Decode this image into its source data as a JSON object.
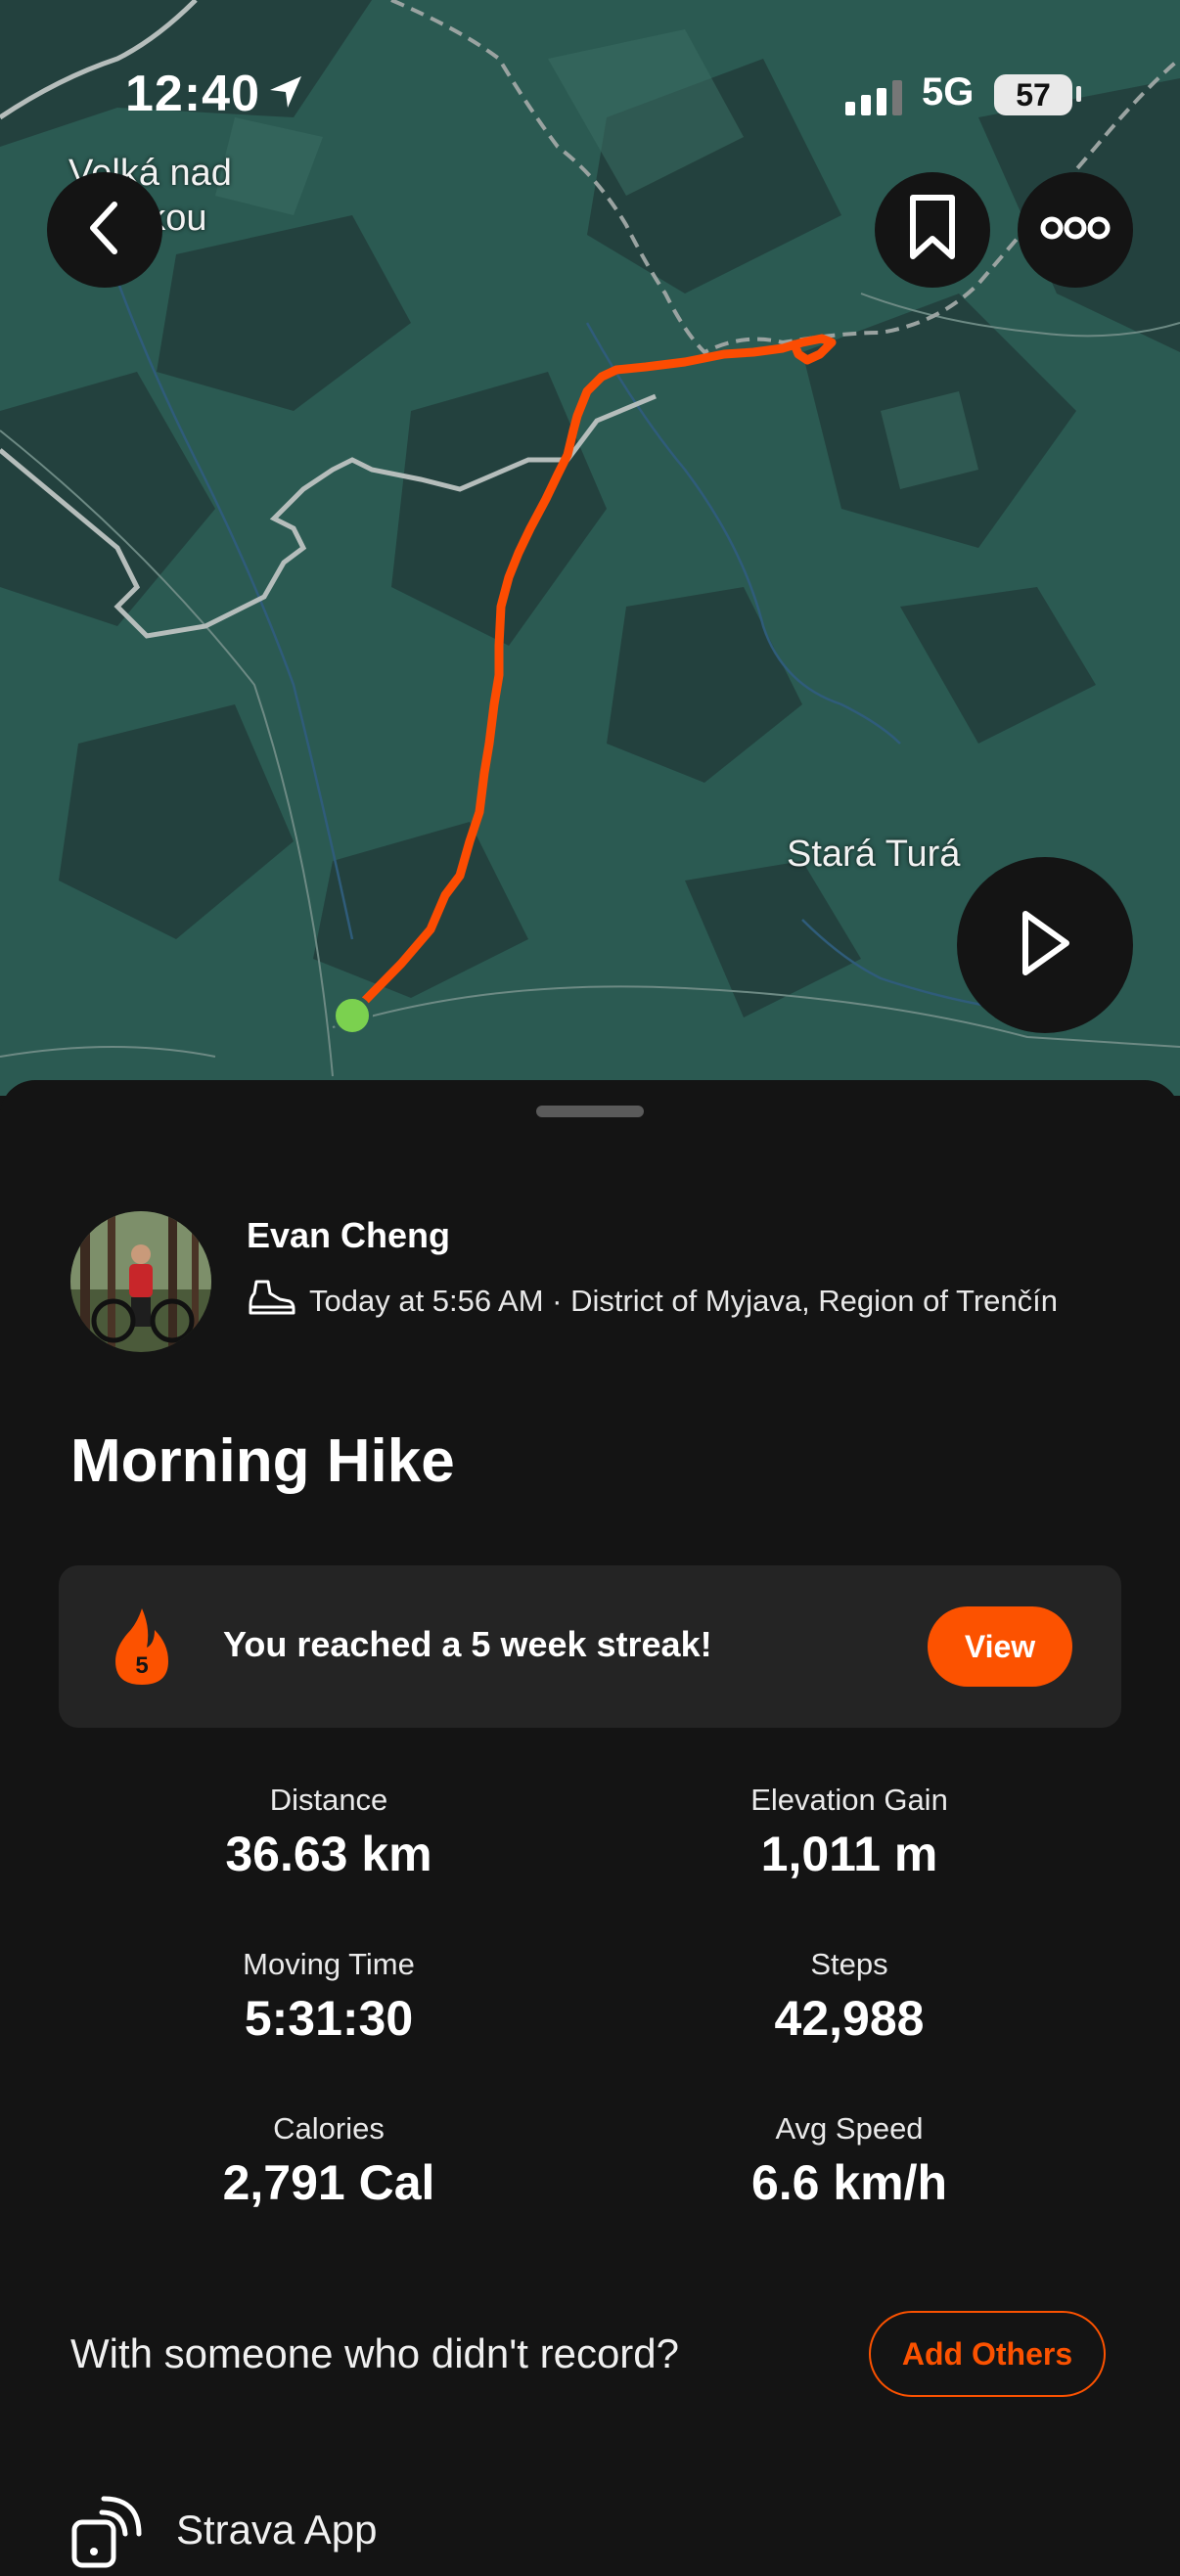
{
  "status_bar": {
    "time": "12:40",
    "network": "5G",
    "battery": "57"
  },
  "map": {
    "labels": [
      "Velká nad",
      "Veličkou",
      "Stará Turá"
    ],
    "colors": {
      "route": "#fc4c02",
      "start_dot": "#7bd14f",
      "terrain": "#2b5a52"
    }
  },
  "header_buttons": {
    "back": "chevron-left-icon",
    "bookmark": "bookmark-icon",
    "more": "more-dots-icon",
    "play": "play-icon"
  },
  "athlete": {
    "name": "Evan Cheng",
    "meta": "Today at 5:56 AM · District of Myjava, Region of Trenčín",
    "activity_icon": "hiking-shoe-icon"
  },
  "activity": {
    "title": "Morning Hike"
  },
  "streak": {
    "badge_number": "5",
    "text": "You reached a 5 week streak!",
    "button": "View"
  },
  "stats": [
    {
      "label": "Distance",
      "value": "36.63 km"
    },
    {
      "label": "Elevation Gain",
      "value": "1,011 m"
    },
    {
      "label": "Moving Time",
      "value": "5:31:30"
    },
    {
      "label": "Steps",
      "value": "42,988"
    },
    {
      "label": "Calories",
      "value": "2,791 Cal"
    },
    {
      "label": "Avg Speed",
      "value": "6.6 km/h"
    }
  ],
  "with_others": {
    "text": "With someone who didn't record?",
    "button": "Add Others"
  },
  "device": {
    "name": "Strava App"
  },
  "accent": "#fc5200"
}
